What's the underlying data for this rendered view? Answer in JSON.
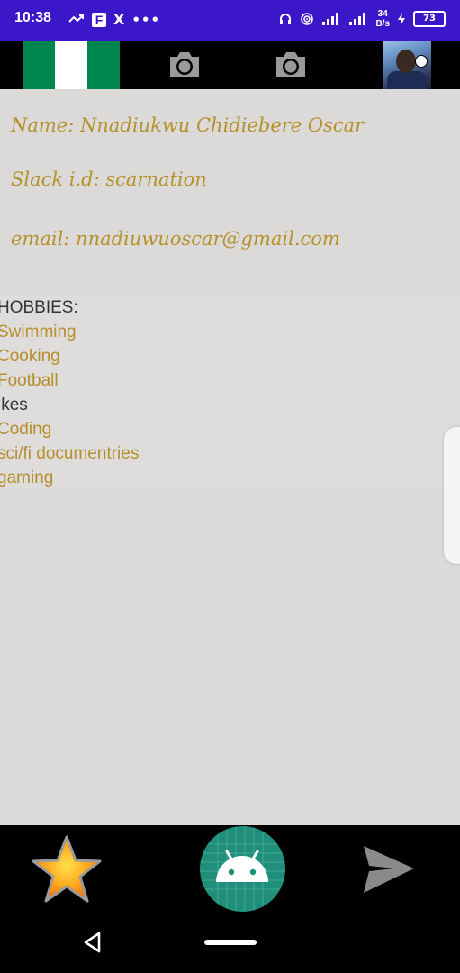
{
  "status_bar": {
    "time": "10:38",
    "fb_icon": "F",
    "x_icon": "X",
    "dots": "•••",
    "net_speed_value": "34",
    "net_speed_unit": "B/s",
    "battery": "73"
  },
  "top_bar": {
    "flag_colors": [
      "#008751",
      "#ffffff",
      "#008751"
    ]
  },
  "profile": {
    "name": "Name: Nnadiukwu Chidiebere Oscar",
    "slack": "Slack i.d: scarnation",
    "email": "email: nnadiuwuoscar@gmail.com"
  },
  "hobbies": {
    "title": "HOBBIES:",
    "items": [
      "Swimming",
      "Cooking",
      "Football",
      "ikes",
      "Coding",
      "sci/fi documentries",
      "gaming"
    ]
  },
  "colors": {
    "accent_gold": "#b5912b",
    "status_bar_bg": "#3b17c9",
    "fab_bg": "#1f8f7b"
  }
}
